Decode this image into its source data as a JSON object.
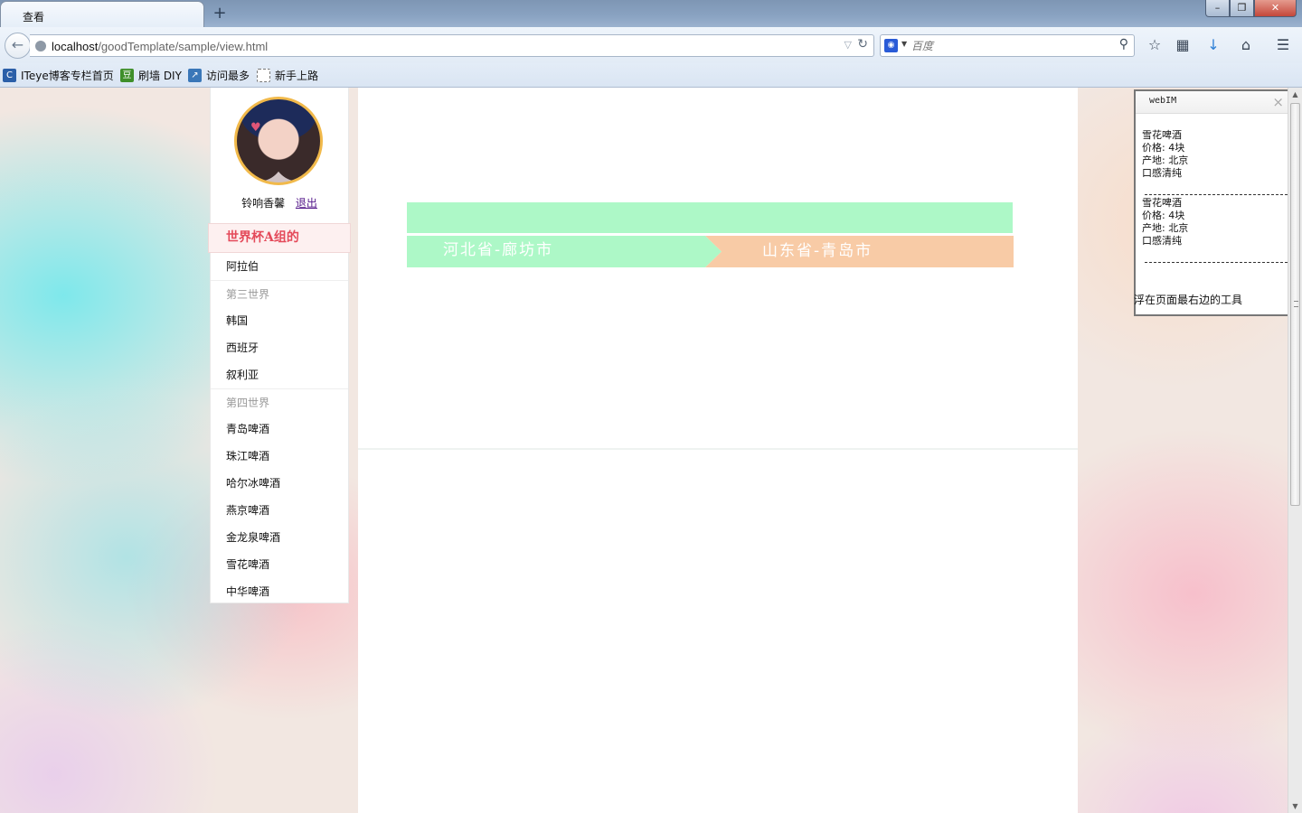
{
  "browser": {
    "tab_title": "查看",
    "new_tab": "+",
    "url_host": "localhost",
    "url_path": "/goodTemplate/sample/view.html",
    "search_placeholder": "百度",
    "window_controls": {
      "minimize": "–",
      "restore": "❐",
      "close": "✕"
    },
    "bookmarks": [
      {
        "label": "ITeye博客专栏首页",
        "icon": "iteye-icon",
        "color": "#2b5fa8"
      },
      {
        "label": "刷墙 DIY",
        "icon": "diy-icon",
        "color": "#3f8f2a"
      },
      {
        "label": "访问最多",
        "icon": "most-visited-icon",
        "color": "#3a77b8"
      },
      {
        "label": "新手上路",
        "icon": "getting-started-icon",
        "color": "#ffffff"
      }
    ]
  },
  "sidebar": {
    "user_name": "铃响香馨",
    "logout_label": "退出",
    "menu_title": "世界杯A组的",
    "menu": [
      {
        "type": "item",
        "label": "阿拉伯"
      },
      {
        "type": "group",
        "label": "第三世界"
      },
      {
        "type": "item",
        "label": "韩国"
      },
      {
        "type": "item",
        "label": "西班牙"
      },
      {
        "type": "item",
        "label": "叙利亚"
      },
      {
        "type": "group",
        "label": "第四世界"
      },
      {
        "type": "item",
        "label": "青岛啤酒"
      },
      {
        "type": "item",
        "label": "珠江啤酒"
      },
      {
        "type": "item",
        "label": "哈尔冰啤酒"
      },
      {
        "type": "item",
        "label": "燕京啤酒"
      },
      {
        "type": "item",
        "label": "金龙泉啤酒"
      },
      {
        "type": "item",
        "label": "雪花啤酒"
      },
      {
        "type": "item",
        "label": "中华啤酒"
      }
    ]
  },
  "steps": {
    "step1": "河北省-廊坊市",
    "step2": "山东省-青岛市",
    "colors": {
      "done": "#adf8c7",
      "current": "#f8cba6"
    }
  },
  "webim": {
    "title": "webIM",
    "messages": [
      [
        "雪花啤酒",
        "价格: 4块",
        "产地: 北京",
        "口感清纯"
      ],
      [
        "雪花啤酒",
        "价格: 4块",
        "产地: 北京",
        "口感清纯"
      ]
    ],
    "footer": "浮在页面最右边的工具"
  }
}
